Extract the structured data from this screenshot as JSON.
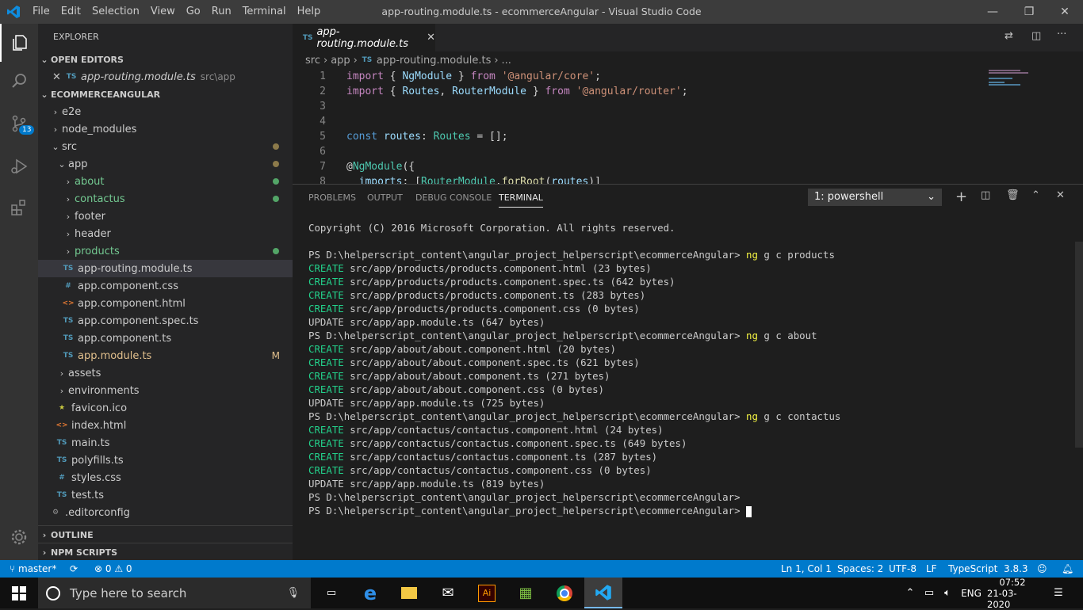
{
  "titlebar": {
    "menu": [
      "File",
      "Edit",
      "Selection",
      "View",
      "Go",
      "Run",
      "Terminal",
      "Help"
    ],
    "window_title": "app-routing.module.ts - ecommerceAngular - Visual Studio Code"
  },
  "activity": {
    "scm_badge": "13"
  },
  "sidebar": {
    "title": "EXPLORER",
    "open_editors_header": "OPEN EDITORS",
    "open_editor": {
      "icon": "TS",
      "name": "app-routing.module.ts",
      "path": "src\\app"
    },
    "project_header": "ECOMMERCEANGULAR",
    "tree": [
      {
        "label": "e2e",
        "icon": "",
        "chev": "›"
      },
      {
        "label": "node_modules",
        "icon": "",
        "chev": "›"
      },
      {
        "label": "src",
        "icon": "",
        "chev": "⌄"
      },
      {
        "label": "app",
        "icon": "",
        "chev": "⌄"
      },
      {
        "label": "about",
        "icon": "",
        "chev": "›"
      },
      {
        "label": "contactus",
        "icon": "",
        "chev": "›"
      },
      {
        "label": "footer",
        "icon": "",
        "chev": "›"
      },
      {
        "label": "header",
        "icon": "",
        "chev": "›"
      },
      {
        "label": "products",
        "icon": "",
        "chev": "›"
      },
      {
        "label": "app-routing.module.ts",
        "icon": "TS",
        "chev": ""
      },
      {
        "label": "app.component.css",
        "icon": "#",
        "chev": ""
      },
      {
        "label": "app.component.html",
        "icon": "<>",
        "chev": ""
      },
      {
        "label": "app.component.spec.ts",
        "icon": "TS",
        "chev": ""
      },
      {
        "label": "app.component.ts",
        "icon": "TS",
        "chev": ""
      },
      {
        "label": "app.module.ts",
        "icon": "TS",
        "chev": "",
        "status": "M"
      },
      {
        "label": "assets",
        "icon": "",
        "chev": "›"
      },
      {
        "label": "environments",
        "icon": "",
        "chev": "›"
      },
      {
        "label": "favicon.ico",
        "icon": "★",
        "chev": ""
      },
      {
        "label": "index.html",
        "icon": "<>",
        "chev": ""
      },
      {
        "label": "main.ts",
        "icon": "TS",
        "chev": ""
      },
      {
        "label": "polyfills.ts",
        "icon": "TS",
        "chev": ""
      },
      {
        "label": "styles.css",
        "icon": "#",
        "chev": ""
      },
      {
        "label": "test.ts",
        "icon": "TS",
        "chev": ""
      },
      {
        "label": ".editorconfig",
        "icon": "⚙",
        "chev": ""
      }
    ],
    "outline_header": "OUTLINE",
    "npm_header": "NPM SCRIPTS"
  },
  "editor": {
    "tab_icon": "TS",
    "tab_label": "app-routing.module.ts",
    "breadcrumb": [
      "src",
      "app",
      "app-routing.module.ts",
      "..."
    ],
    "line_numbers": [
      "1",
      "2",
      "3",
      "4",
      "5",
      "6",
      "7",
      "8"
    ]
  },
  "panel": {
    "tabs": [
      "PROBLEMS",
      "OUTPUT",
      "DEBUG CONSOLE",
      "TERMINAL"
    ],
    "terminal_select": "1: powershell",
    "lines": [
      {
        "a": "Copyright (C) 2016 Microsoft Corporation. All rights reserved.",
        "b": ""
      },
      {
        "a": "",
        "b": ""
      },
      {
        "a": "PS D:\\helperscript_content\\angular_project_helperscript\\ecommerceAngular> ",
        "b": "ng",
        "c": " g c products"
      },
      {
        "k": "CREATE",
        "a": " src/app/products/products.component.html (23 bytes)"
      },
      {
        "k": "CREATE",
        "a": " src/app/products/products.component.spec.ts (642 bytes)"
      },
      {
        "k": "CREATE",
        "a": " src/app/products/products.component.ts (283 bytes)"
      },
      {
        "k": "CREATE",
        "a": " src/app/products/products.component.css (0 bytes)"
      },
      {
        "a": "UPDATE src/app/app.module.ts (647 bytes)",
        "b": ""
      },
      {
        "a": "PS D:\\helperscript_content\\angular_project_helperscript\\ecommerceAngular> ",
        "b": "ng",
        "c": " g c about"
      },
      {
        "k": "CREATE",
        "a": " src/app/about/about.component.html (20 bytes)"
      },
      {
        "k": "CREATE",
        "a": " src/app/about/about.component.spec.ts (621 bytes)"
      },
      {
        "k": "CREATE",
        "a": " src/app/about/about.component.ts (271 bytes)"
      },
      {
        "k": "CREATE",
        "a": " src/app/about/about.component.css (0 bytes)"
      },
      {
        "a": "UPDATE src/app/app.module.ts (725 bytes)",
        "b": ""
      },
      {
        "a": "PS D:\\helperscript_content\\angular_project_helperscript\\ecommerceAngular> ",
        "b": "ng",
        "c": " g c contactus"
      },
      {
        "k": "CREATE",
        "a": " src/app/contactus/contactus.component.html (24 bytes)"
      },
      {
        "k": "CREATE",
        "a": " src/app/contactus/contactus.component.spec.ts (649 bytes)"
      },
      {
        "k": "CREATE",
        "a": " src/app/contactus/contactus.component.ts (287 bytes)"
      },
      {
        "k": "CREATE",
        "a": " src/app/contactus/contactus.component.css (0 bytes)"
      },
      {
        "a": "UPDATE src/app/app.module.ts (819 bytes)",
        "b": ""
      },
      {
        "a": "PS D:\\helperscript_content\\angular_project_helperscript\\ecommerceAngular>",
        "b": ""
      },
      {
        "a": "PS D:\\helperscript_content\\angular_project_helperscript\\ecommerceAngular> ",
        "b": "",
        "cursor": true
      }
    ]
  },
  "statusbar": {
    "branch": "master*",
    "problems": "⊗ 0 ⚠ 0",
    "position": "Ln 1, Col 1",
    "spaces": "Spaces: 2",
    "encoding": "UTF-8",
    "eol": "LF",
    "language": "TypeScript",
    "version": "3.8.3"
  },
  "taskbar": {
    "search_placeholder": "Type here to search",
    "lang": "ENG",
    "time": "07:52",
    "date": "21-03-2020"
  },
  "colors": {
    "accent": "#007acc",
    "modified": "#e2c08d",
    "untracked": "#73c991"
  }
}
